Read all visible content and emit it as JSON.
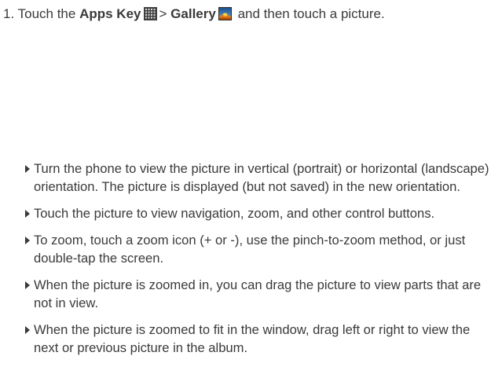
{
  "step": {
    "number": "1.",
    "text_before": "Touch the",
    "apps_key_label": "Apps Key",
    "separator": ">",
    "gallery_label": "Gallery",
    "text_after": "and then touch a picture."
  },
  "icons": {
    "apps_key": "apps-grid-icon",
    "gallery": "gallery-landscape-icon"
  },
  "bullets": [
    "Turn the phone to view the picture in vertical (portrait) or horizontal (landscape) orientation. The picture is displayed (but not saved) in the new orientation.",
    "Touch the picture to view navigation, zoom, and other control buttons.",
    "To zoom, touch a zoom icon (+ or -), use the pinch-to-zoom method, or just double-tap the screen.",
    "When the picture is zoomed in, you can drag the picture to view parts that are not in view.",
    "When the picture is zoomed to fit in the window, drag left or right to view the next or previous picture in the album."
  ]
}
